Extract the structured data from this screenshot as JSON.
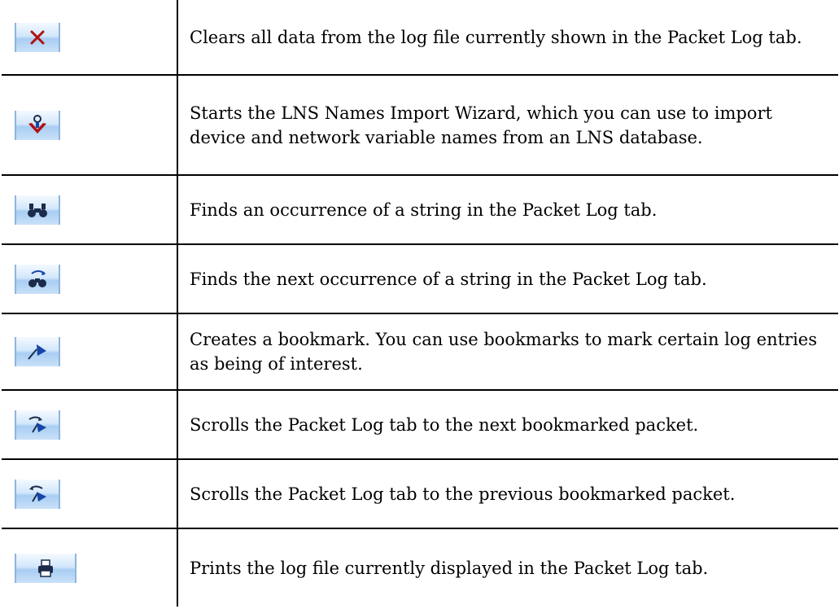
{
  "rows": [
    {
      "icon": "clear-log-icon",
      "text": "Clears all data from the log file currently shown in the Packet Log tab."
    },
    {
      "icon": "lns-import-icon",
      "text": "Starts the LNS Names Import Wizard, which you can use to import device and network variable names from an LNS database."
    },
    {
      "icon": "find-binoculars-icon",
      "text": "Finds an occurrence of a string in the Packet Log tab."
    },
    {
      "icon": "find-next-icon",
      "text": "Finds the next occurrence of a string in the Packet Log tab."
    },
    {
      "icon": "bookmark-flag-icon",
      "text": "Creates a bookmark.  You can use bookmarks to mark certain log entries as being of interest."
    },
    {
      "icon": "next-bookmark-icon",
      "text": "Scrolls the Packet Log tab to the next bookmarked packet."
    },
    {
      "icon": "previous-bookmark-icon",
      "text": "Scrolls the Packet Log tab to the previous bookmarked packet."
    },
    {
      "icon": "print-icon",
      "text": "Prints the log file currently displayed in the Packet Log tab."
    }
  ],
  "colors": {
    "icon_red": "#b01010",
    "icon_blue": "#1546a8",
    "icon_dark": "#1c2b4a"
  }
}
